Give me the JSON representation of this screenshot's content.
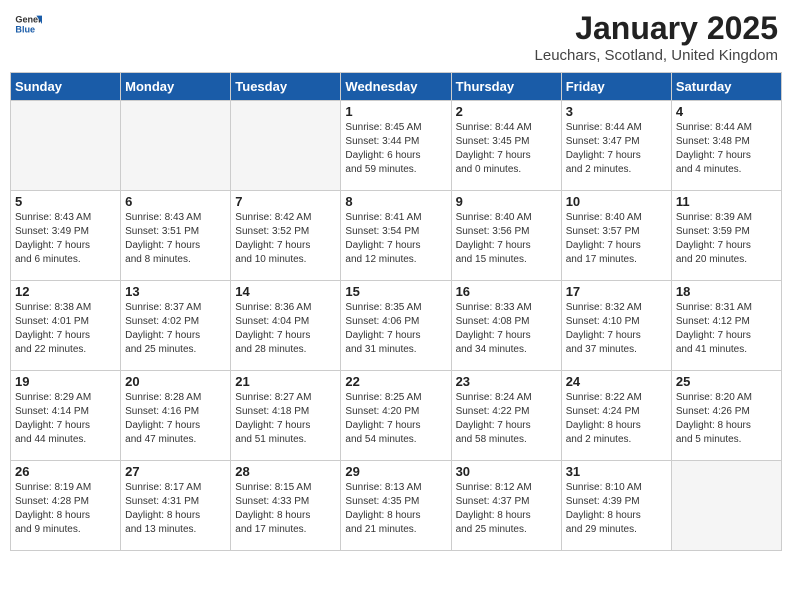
{
  "header": {
    "logo_general": "General",
    "logo_blue": "Blue",
    "month_title": "January 2025",
    "location": "Leuchars, Scotland, United Kingdom"
  },
  "weekdays": [
    "Sunday",
    "Monday",
    "Tuesday",
    "Wednesday",
    "Thursday",
    "Friday",
    "Saturday"
  ],
  "weeks": [
    [
      {
        "day": "",
        "info": ""
      },
      {
        "day": "",
        "info": ""
      },
      {
        "day": "",
        "info": ""
      },
      {
        "day": "1",
        "info": "Sunrise: 8:45 AM\nSunset: 3:44 PM\nDaylight: 6 hours\nand 59 minutes."
      },
      {
        "day": "2",
        "info": "Sunrise: 8:44 AM\nSunset: 3:45 PM\nDaylight: 7 hours\nand 0 minutes."
      },
      {
        "day": "3",
        "info": "Sunrise: 8:44 AM\nSunset: 3:47 PM\nDaylight: 7 hours\nand 2 minutes."
      },
      {
        "day": "4",
        "info": "Sunrise: 8:44 AM\nSunset: 3:48 PM\nDaylight: 7 hours\nand 4 minutes."
      }
    ],
    [
      {
        "day": "5",
        "info": "Sunrise: 8:43 AM\nSunset: 3:49 PM\nDaylight: 7 hours\nand 6 minutes."
      },
      {
        "day": "6",
        "info": "Sunrise: 8:43 AM\nSunset: 3:51 PM\nDaylight: 7 hours\nand 8 minutes."
      },
      {
        "day": "7",
        "info": "Sunrise: 8:42 AM\nSunset: 3:52 PM\nDaylight: 7 hours\nand 10 minutes."
      },
      {
        "day": "8",
        "info": "Sunrise: 8:41 AM\nSunset: 3:54 PM\nDaylight: 7 hours\nand 12 minutes."
      },
      {
        "day": "9",
        "info": "Sunrise: 8:40 AM\nSunset: 3:56 PM\nDaylight: 7 hours\nand 15 minutes."
      },
      {
        "day": "10",
        "info": "Sunrise: 8:40 AM\nSunset: 3:57 PM\nDaylight: 7 hours\nand 17 minutes."
      },
      {
        "day": "11",
        "info": "Sunrise: 8:39 AM\nSunset: 3:59 PM\nDaylight: 7 hours\nand 20 minutes."
      }
    ],
    [
      {
        "day": "12",
        "info": "Sunrise: 8:38 AM\nSunset: 4:01 PM\nDaylight: 7 hours\nand 22 minutes."
      },
      {
        "day": "13",
        "info": "Sunrise: 8:37 AM\nSunset: 4:02 PM\nDaylight: 7 hours\nand 25 minutes."
      },
      {
        "day": "14",
        "info": "Sunrise: 8:36 AM\nSunset: 4:04 PM\nDaylight: 7 hours\nand 28 minutes."
      },
      {
        "day": "15",
        "info": "Sunrise: 8:35 AM\nSunset: 4:06 PM\nDaylight: 7 hours\nand 31 minutes."
      },
      {
        "day": "16",
        "info": "Sunrise: 8:33 AM\nSunset: 4:08 PM\nDaylight: 7 hours\nand 34 minutes."
      },
      {
        "day": "17",
        "info": "Sunrise: 8:32 AM\nSunset: 4:10 PM\nDaylight: 7 hours\nand 37 minutes."
      },
      {
        "day": "18",
        "info": "Sunrise: 8:31 AM\nSunset: 4:12 PM\nDaylight: 7 hours\nand 41 minutes."
      }
    ],
    [
      {
        "day": "19",
        "info": "Sunrise: 8:29 AM\nSunset: 4:14 PM\nDaylight: 7 hours\nand 44 minutes."
      },
      {
        "day": "20",
        "info": "Sunrise: 8:28 AM\nSunset: 4:16 PM\nDaylight: 7 hours\nand 47 minutes."
      },
      {
        "day": "21",
        "info": "Sunrise: 8:27 AM\nSunset: 4:18 PM\nDaylight: 7 hours\nand 51 minutes."
      },
      {
        "day": "22",
        "info": "Sunrise: 8:25 AM\nSunset: 4:20 PM\nDaylight: 7 hours\nand 54 minutes."
      },
      {
        "day": "23",
        "info": "Sunrise: 8:24 AM\nSunset: 4:22 PM\nDaylight: 7 hours\nand 58 minutes."
      },
      {
        "day": "24",
        "info": "Sunrise: 8:22 AM\nSunset: 4:24 PM\nDaylight: 8 hours\nand 2 minutes."
      },
      {
        "day": "25",
        "info": "Sunrise: 8:20 AM\nSunset: 4:26 PM\nDaylight: 8 hours\nand 5 minutes."
      }
    ],
    [
      {
        "day": "26",
        "info": "Sunrise: 8:19 AM\nSunset: 4:28 PM\nDaylight: 8 hours\nand 9 minutes."
      },
      {
        "day": "27",
        "info": "Sunrise: 8:17 AM\nSunset: 4:31 PM\nDaylight: 8 hours\nand 13 minutes."
      },
      {
        "day": "28",
        "info": "Sunrise: 8:15 AM\nSunset: 4:33 PM\nDaylight: 8 hours\nand 17 minutes."
      },
      {
        "day": "29",
        "info": "Sunrise: 8:13 AM\nSunset: 4:35 PM\nDaylight: 8 hours\nand 21 minutes."
      },
      {
        "day": "30",
        "info": "Sunrise: 8:12 AM\nSunset: 4:37 PM\nDaylight: 8 hours\nand 25 minutes."
      },
      {
        "day": "31",
        "info": "Sunrise: 8:10 AM\nSunset: 4:39 PM\nDaylight: 8 hours\nand 29 minutes."
      },
      {
        "day": "",
        "info": ""
      }
    ]
  ]
}
